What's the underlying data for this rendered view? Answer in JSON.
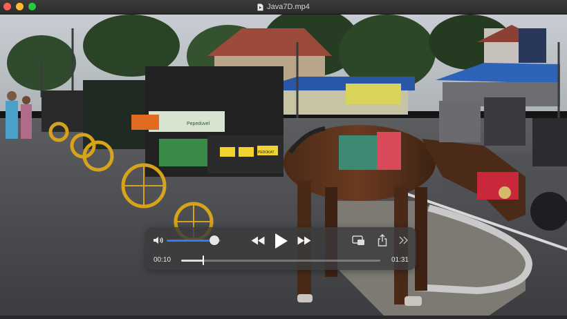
{
  "window": {
    "title": "Java7D.mp4",
    "colors": {
      "close": "#ff5f57",
      "minimize": "#febc2e",
      "maximize": "#28c840"
    }
  },
  "scene": {
    "carriage_sign_1": "Pepeduvel",
    "plate_1": "",
    "plate_2": "PEDOKAT"
  },
  "player": {
    "volume_percent": 88,
    "elapsed": "00:10",
    "duration": "01:31",
    "progress_fraction": 0.11,
    "accent_color": "#2f7cf6",
    "icons": [
      "speaker-icon",
      "rewind-icon",
      "play-icon",
      "fast-forward-icon",
      "picture-in-picture-icon",
      "share-icon",
      "chevron-double-right-icon"
    ]
  }
}
